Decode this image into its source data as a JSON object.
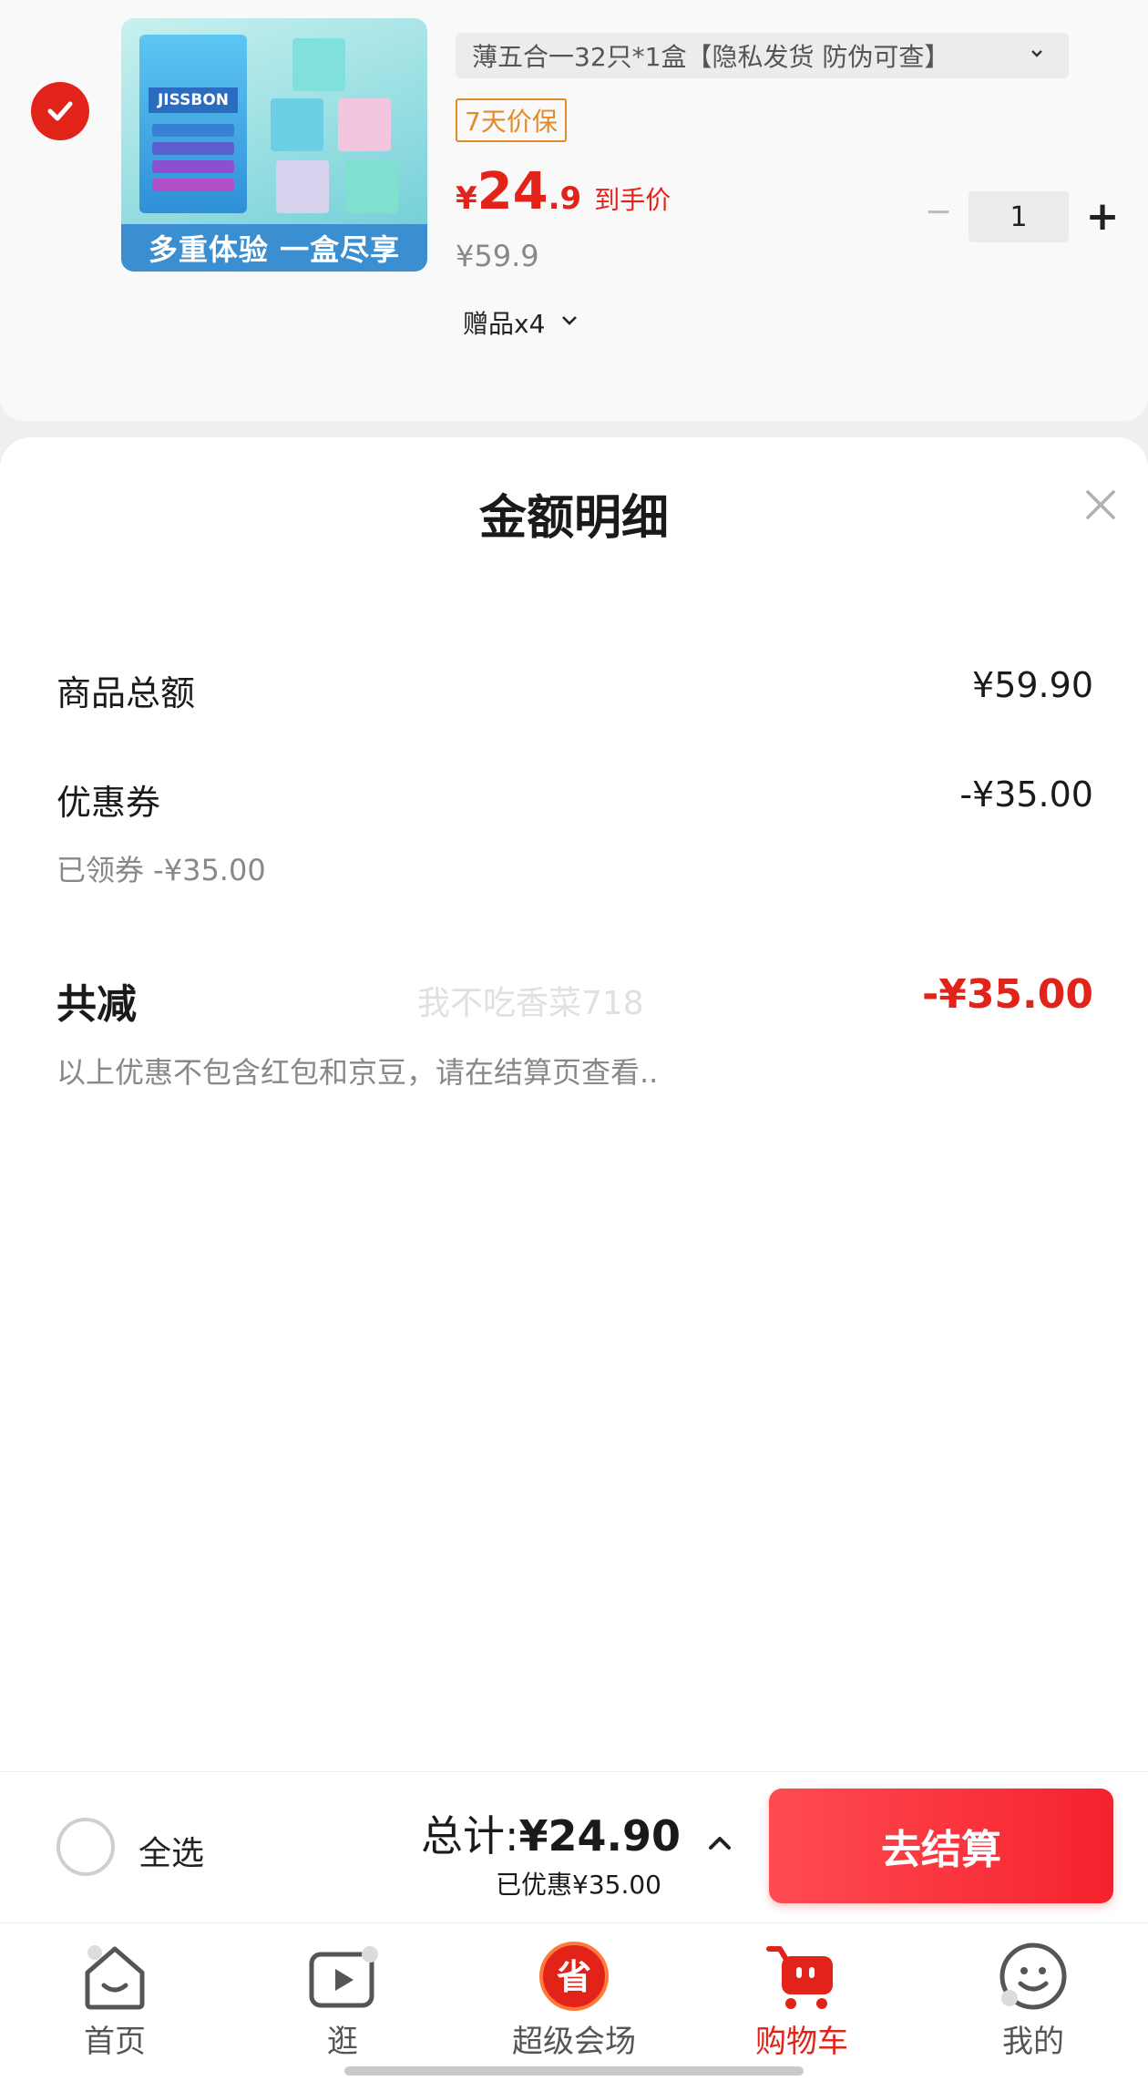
{
  "cart_item": {
    "selected": true,
    "image_banner": "多重体验 一盒尽享",
    "image_brand": "JISSBON",
    "sku": "薄五合一32只*1盒【隐私发货 防伪可查】",
    "badge": "7天价保",
    "price_currency": "¥",
    "price_integer": "24",
    "price_decimal": ".9",
    "price_tag": "到手价",
    "original_price": "¥59.9",
    "quantity": "1",
    "qty_minus": "−",
    "qty_plus": "+",
    "gift": "赠品x4"
  },
  "sheet": {
    "title": "金额明细",
    "rows": [
      {
        "label": "商品总额",
        "value": "¥59.90"
      },
      {
        "label": "优惠券",
        "value": "-¥35.00",
        "note": "已领券 -¥35.00"
      }
    ],
    "total_label": "共减",
    "total_value": "-¥35.00",
    "watermark": "我不吃香菜718",
    "note": "以上优惠不包含红包和京豆，请在结算页查看.."
  },
  "checkout": {
    "select_all": "全选",
    "total_label": "总计:",
    "total_amount": "¥24.90",
    "saved": "已优惠¥35.00",
    "button": "去结算"
  },
  "tabs": [
    {
      "label": "首页",
      "icon": "home-icon"
    },
    {
      "label": "逛",
      "icon": "video-icon"
    },
    {
      "label": "超级会场",
      "icon": "super-venue-icon"
    },
    {
      "label": "购物车",
      "icon": "cart-icon",
      "active": true
    },
    {
      "label": "我的",
      "icon": "profile-icon"
    }
  ],
  "colors": {
    "accent": "#e2231a",
    "badge": "#e08a2a",
    "checkout_button": "#f5222d"
  }
}
